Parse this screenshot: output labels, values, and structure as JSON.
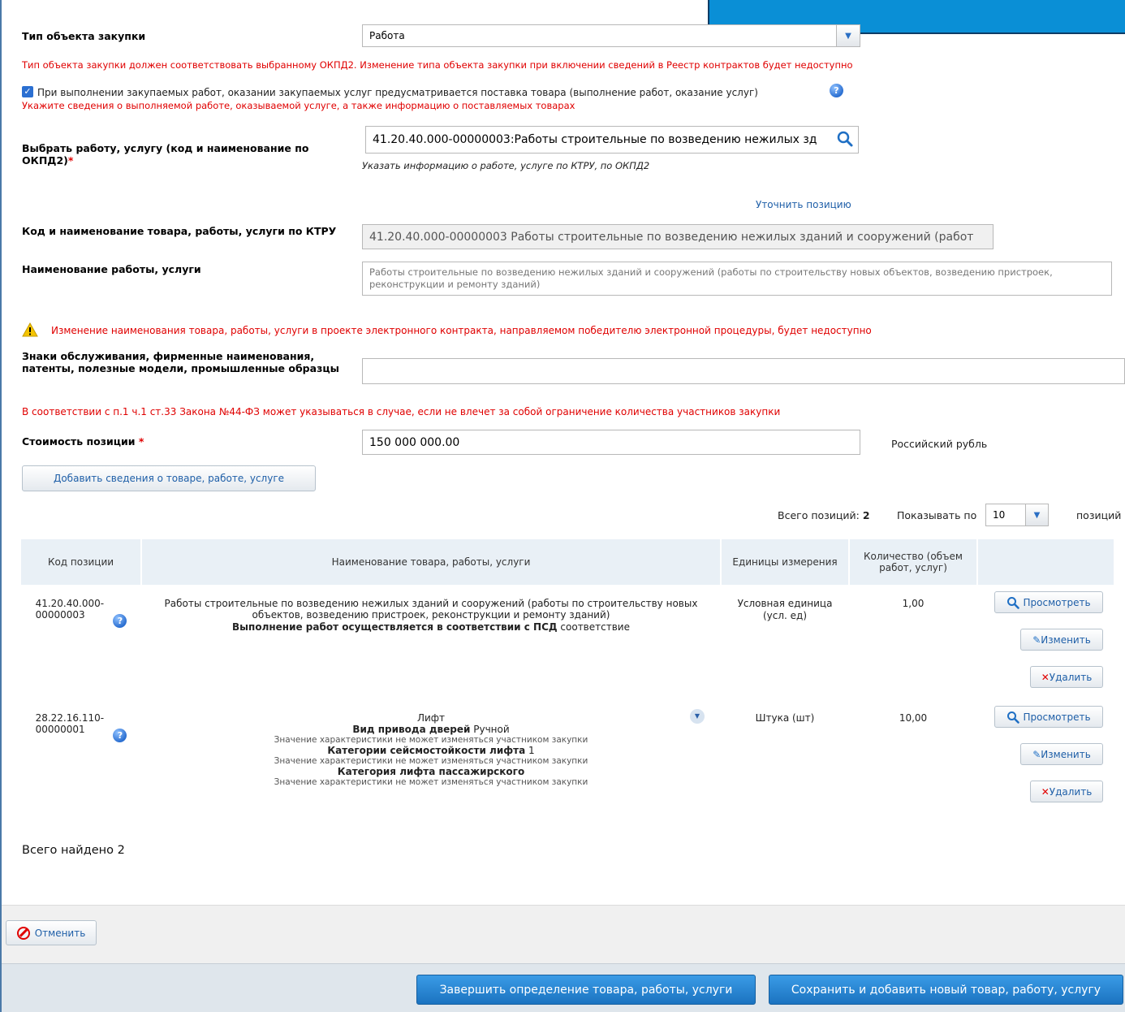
{
  "form": {
    "object_type_label": "Тип объекта закупки",
    "object_type_value": "Работа",
    "object_type_warning": "Тип объекта закупки должен соответствовать выбранному ОКПД2. Изменение типа объекта закупки при включении сведений в Реестр контрактов будет недоступно",
    "goods_supply_checkbox_label": "При выполнении закупаемых работ, оказании закупаемых услуг предусматривается поставка товара (выполнение работ, оказание услуг)",
    "goods_supply_hint": "Укажите сведения о выполняемой работе, оказываемой услуге, а также информацию о поставляемых товарах",
    "select_work_label": "Выбрать работу, услугу (код и наименование по ОКПД2)",
    "select_work_required": "*",
    "select_work_value": "41.20.40.000-00000003:Работы строительные по возведению нежилых зд",
    "select_work_hint": "Указать информацию о работе, услуге по КТРУ, по ОКПД2",
    "refine_link": "Уточнить позицию",
    "ktru_label": "Код и наименование товара, работы, услуги по КТРУ",
    "ktru_value": "41.20.40.000-00000003 Работы строительные по возведению нежилых зданий и сооружений (работ",
    "name_label": "Наименование работы, услуги",
    "name_placeholder": "Работы строительные по возведению нежилых зданий и сооружений (работы по строительству новых объектов, возведению пристроек, реконструкции и ремонту зданий)",
    "name_warning": "Изменение наименования товара, работы, услуги в проекте электронного контракта, направляемом победителю электронной процедуры, будет недоступно",
    "trademarks_label": "Знаки обслуживания, фирменные наименования, патенты, полезные модели, промышленные образцы",
    "trademarks_value": "",
    "trademarks_warning": "В соответствии с п.1 ч.1 ст.33 Закона №44-ФЗ может указываться в случае, если не влечет за собой ограничение количества участников закупки",
    "cost_label": "Стоимость позиции",
    "cost_required": "*",
    "cost_value": "150 000 000.00",
    "currency": "Российский рубль",
    "add_item_button": "Добавить сведения о товаре, работе, услуге"
  },
  "pager": {
    "total_label": "Всего позиций:",
    "total_value": "2",
    "show_by_label": "Показывать по",
    "show_by_value": "10",
    "positions_label": "позиций"
  },
  "table": {
    "headers": [
      "Код позиции",
      "Наименование товара, работы, услуги",
      "Единицы измерения",
      "Количество (объем работ, услуг)"
    ],
    "rows": [
      {
        "code": "41.20.40.000-00000003",
        "name": "Работы строительные по возведению нежилых зданий и сооружений (работы по строительству новых объектов, возведению пристроек, реконструкции и ремонту зданий)",
        "char_name": "Выполнение работ осуществляется в соответствии с ПСД",
        "char_value": "соответствие",
        "unit": "Условная единица (усл. ед)",
        "quantity": "1,00"
      },
      {
        "code": "28.22.16.110-00000001",
        "name": "Лифт",
        "chars": [
          {
            "name": "Вид привода дверей",
            "value": "Ручной",
            "note": "Значение характеристики не может изменяться участником закупки"
          },
          {
            "name": "Категории сейсмостойкости лифта",
            "value": "1",
            "note": "Значение характеристики не может изменяться участником закупки"
          },
          {
            "name": "Категория лифта пассажирского",
            "value": "",
            "note": "Значение характеристики не может изменяться участником закупки"
          }
        ],
        "unit": "Штука (шт)",
        "quantity": "10,00"
      }
    ],
    "actions": {
      "view": "Просмотреть",
      "edit": "Изменить",
      "delete": "Удалить"
    }
  },
  "total_found": "Всего найдено 2",
  "footer": {
    "cancel_button": "Отменить",
    "finish_button": "Завершить определение товара, работы, услуги",
    "save_add_button": "Сохранить и добавить новый товар, работу, услугу"
  },
  "colors": {
    "accent": "#0a8fd6",
    "error": "#e00000",
    "link": "#1f5fa8"
  }
}
